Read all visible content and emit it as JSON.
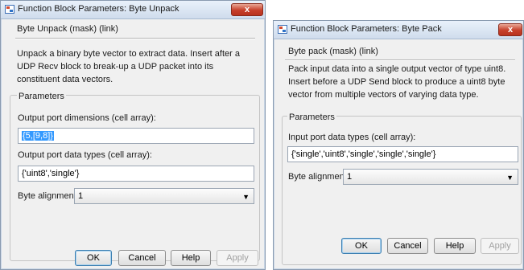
{
  "unpack": {
    "title": "Function Block Parameters: Byte Unpack",
    "close": "x",
    "header": "Byte Unpack (mask) (link)",
    "description": "Unpack a binary byte vector to extract data. Insert after a UDP Recv block to break-up a UDP packet into its constituent data vectors.",
    "group_title": "Parameters",
    "dims_label": "Output port dimensions (cell array):",
    "dims_value": "{5,[9,8]}",
    "types_label": "Output port data types (cell array):",
    "types_value": "{'uint8','single'}",
    "align_label": "Byte alignment:",
    "align_value": "1",
    "ok": "OK",
    "cancel": "Cancel",
    "help": "Help",
    "apply": "Apply"
  },
  "pack": {
    "title": "Function Block Parameters: Byte Pack",
    "close": "x",
    "header": "Byte pack (mask) (link)",
    "description": "Pack input data into a single output vector of type uint8. Insert before a UDP Send block to produce a uint8 byte vector from multiple vectors of varying data type.",
    "group_title": "Parameters",
    "types_label": "Input port data types (cell array):",
    "types_value": "{'single','uint8','single','single','single'}",
    "align_label": "Byte alignment:",
    "align_value": "1",
    "ok": "OK",
    "cancel": "Cancel",
    "help": "Help",
    "apply": "Apply"
  },
  "icons": {
    "app": "simulink-block-icon",
    "close": "close-icon",
    "dropdown": "chevron-down-icon",
    "dropdown_glyph": "▼"
  }
}
